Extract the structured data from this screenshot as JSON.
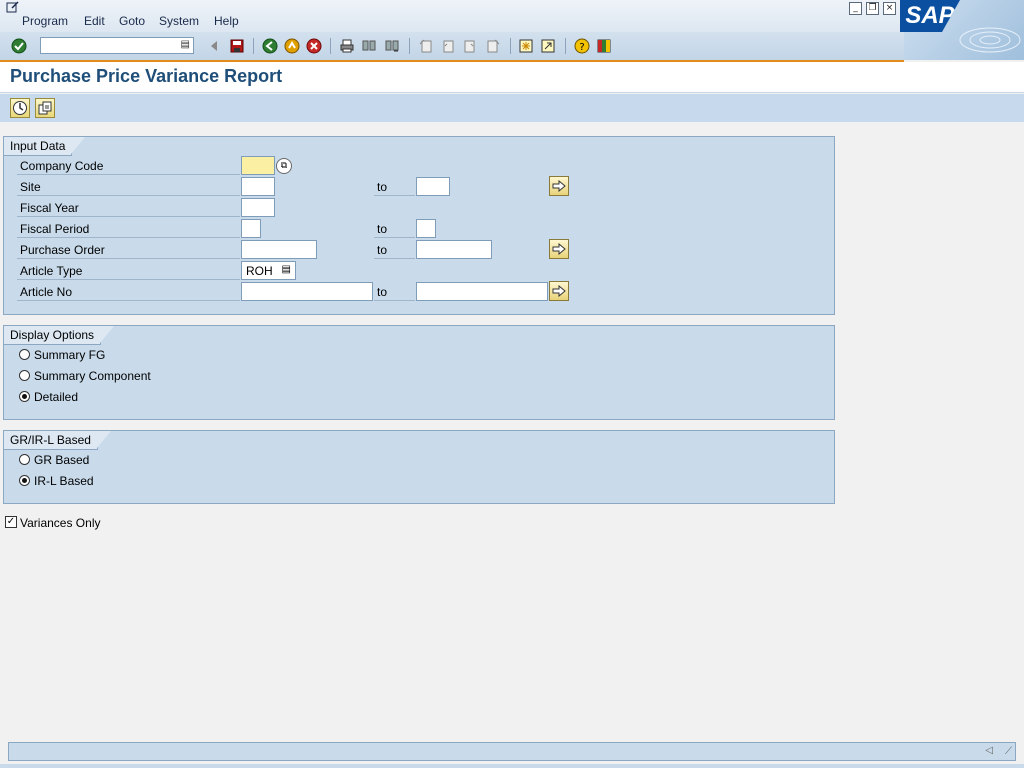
{
  "menu": {
    "items": [
      "Program",
      "Edit",
      "Goto",
      "System",
      "Help"
    ]
  },
  "toolbar": {
    "command_value": "",
    "icons": [
      "enter-icon",
      "back-arrow-icon",
      "save-icon",
      "back-icon",
      "exit-icon",
      "cancel-icon",
      "print-icon",
      "find-icon",
      "find-next-icon",
      "first-page-icon",
      "previous-page-icon",
      "next-page-icon",
      "last-page-icon",
      "new-session-icon",
      "shortcut-icon",
      "help-icon",
      "layout-icon"
    ]
  },
  "logo": {
    "text": "SAP"
  },
  "page": {
    "title": "Purchase Price Variance Report"
  },
  "app_toolbar": {
    "icons": [
      "execute-icon",
      "get-variant-icon"
    ]
  },
  "input_data": {
    "title": "Input Data",
    "company_code": {
      "label": "Company Code",
      "value": ""
    },
    "site": {
      "label": "Site",
      "from": "",
      "to_label": "to",
      "to": ""
    },
    "fiscal_year": {
      "label": "Fiscal  Year",
      "value": ""
    },
    "fiscal_period": {
      "label": "Fiscal Period",
      "from": "",
      "to_label": "to",
      "to": ""
    },
    "purchase_order": {
      "label": "Purchase Order",
      "from": "",
      "to_label": "to",
      "to": ""
    },
    "article_type": {
      "label": "Article Type",
      "value": "ROH"
    },
    "article_no": {
      "label": "Article No",
      "from": "",
      "to_label": "to",
      "to": ""
    }
  },
  "display_options": {
    "title": "Display Options",
    "options": [
      {
        "label": "Summary FG",
        "selected": false
      },
      {
        "label": "Summary  Component",
        "selected": false
      },
      {
        "label": "Detailed",
        "selected": true
      }
    ]
  },
  "grir": {
    "title": "GR/IR-L Based",
    "options": [
      {
        "label": "GR Based",
        "selected": false
      },
      {
        "label": "IR-L Based",
        "selected": true
      }
    ]
  },
  "variances_only": {
    "label": "Variances  Only",
    "checked": true
  },
  "status": {
    "text": ""
  }
}
